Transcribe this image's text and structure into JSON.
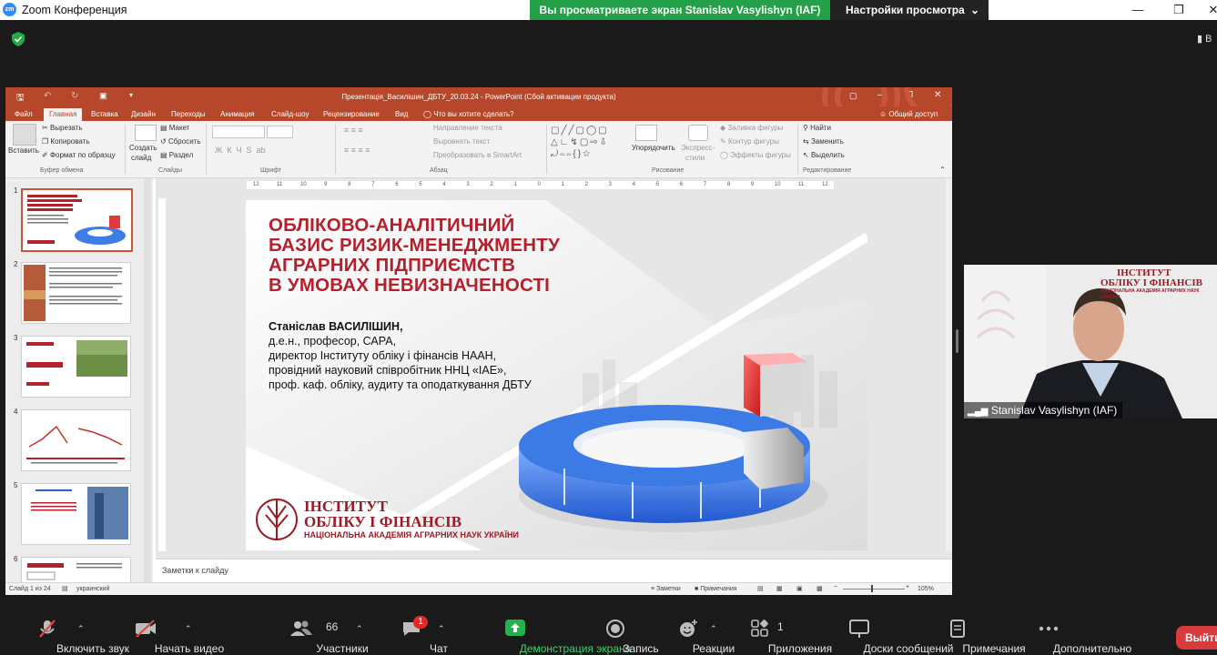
{
  "zoom": {
    "logo": "zm",
    "window_title": "Zoom Конференция",
    "share_banner": "Вы просматриваете экран Stanislav Vasylishyn (IAF)",
    "view_settings": "Настройки просмотра",
    "right_edge_label": "В",
    "toolbar": {
      "audio": "Включить звук",
      "video": "Начать видео",
      "participants": "Участники",
      "participants_count": "66",
      "chat": "Чат",
      "chat_badge": "1",
      "share": "Демонстрация экрана",
      "record": "Запись",
      "reactions": "Реакции",
      "apps": "Приложения",
      "apps_count": "1",
      "whiteboards": "Доски сообщений",
      "notes": "Примечания",
      "more": "Дополнительно",
      "leave": "Выйти"
    },
    "participant_name": "Stanislav Vasylishyn (IAF)",
    "colors": {
      "share_green": "#24a148",
      "leave_red": "#d83b3b",
      "ppt_red": "#b7472a",
      "slide_red": "#b2212c"
    }
  },
  "ppt": {
    "title": "Презентація_Василішин_ДБТУ_20.03.24 - PowerPoint (Сбой активации продукта)",
    "menu": [
      "Файл",
      "Главная",
      "Вставка",
      "Дизайн",
      "Переходы",
      "Анимация",
      "Слайд-шоу",
      "Рецензирование",
      "Вид"
    ],
    "tell_me": "Что вы хотите сделать?",
    "share": "Общий доступ",
    "ribbon": {
      "paste": "Вставить",
      "cut": "Вырезать",
      "copy": "Копировать",
      "format_painter": "Формат по образцу",
      "clipboard": "Буфер обмена",
      "new_slide_1": "Создать",
      "new_slide_2": "слайд",
      "layout": "Макет",
      "reset": "Сбросить",
      "section": "Раздел",
      "slides": "Слайды",
      "font": "Шрифт",
      "text_direction": "Направление текста",
      "align_text": "Выровнять текст",
      "smartart": "Преобразовать в SmartArt",
      "paragraph": "Абзац",
      "arrange": "Упорядочить",
      "quick_styles_1": "Экспресс-",
      "quick_styles_2": "стили",
      "shape_fill": "Заливка фигуры",
      "shape_outline": "Контур фигуры",
      "shape_effects": "Эффекты фигуры",
      "drawing": "Рисование",
      "find": "Найти",
      "replace": "Заменить",
      "select": "Выделить",
      "editing": "Редактирование"
    },
    "ruler_labels": [
      "12",
      "11",
      "10",
      "9",
      "8",
      "7",
      "6",
      "5",
      "4",
      "3",
      "2",
      "1",
      "0",
      "1",
      "2",
      "3",
      "4",
      "5",
      "6",
      "7",
      "8",
      "9",
      "10",
      "11",
      "12"
    ],
    "slide_numbers": [
      "1",
      "2",
      "3",
      "4",
      "5",
      "6"
    ],
    "slide": {
      "title_lines": [
        "ОБЛІКОВО-АНАЛІТИЧНИЙ",
        "БАЗИС РИЗИК-МЕНЕДЖМЕНТУ",
        "АГРАРНИХ ПІДПРИЄМСТВ",
        "В УМОВАХ НЕВИЗНАЧЕНОСТІ"
      ],
      "author_name": "Станіслав ВАСИЛІШИН,",
      "author_lines": [
        "д.е.н., професор, САРА,",
        "директор Інституту обліку і фінансів НААН,",
        "провідний науковий співробітник ННЦ «ІАЕ»,",
        "проф. каф. обліку, аудиту та оподаткування ДБТУ"
      ],
      "logo_line1": "ІНСТИТУТ",
      "logo_line2": "ОБЛІКУ І ФІНАНСІВ",
      "logo_line3": "НАЦІОНАЛЬНА АКАДЕМІЯ АГРАРНИХ НАУК УКРАЇНИ"
    },
    "notes_placeholder": "Заметки к слайду",
    "status": {
      "slide_of": "Слайд 1 из 24",
      "language": "украинский",
      "notes": "Заметки",
      "comments": "Примечания",
      "zoom": "105%"
    }
  },
  "webcam_logo": {
    "line1": "ІНСТИТУТ",
    "line2": "ОБЛІКУ І ФІНАНСІВ",
    "line3": "НАЦІОНАЛЬНА АКАДЕМІЯ АГРАРНИХ НАУК УКРАЇНИ"
  }
}
